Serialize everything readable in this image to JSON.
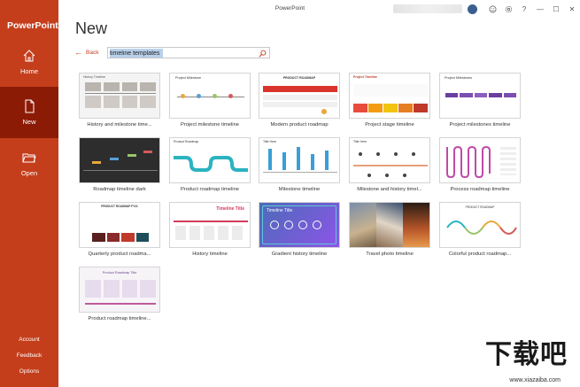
{
  "app": {
    "brand": "PowerPoint",
    "window_title": "PowerPoint"
  },
  "sidebar": {
    "items": [
      {
        "label": "Home",
        "icon": "home-icon"
      },
      {
        "label": "New",
        "icon": "new-file-icon"
      },
      {
        "label": "Open",
        "icon": "folder-open-icon"
      }
    ],
    "bottom": [
      "Account",
      "Feedback",
      "Options"
    ]
  },
  "titlebar": {
    "avatar_initials": "",
    "help": "?",
    "min": "—",
    "max": "☐",
    "close": "✕"
  },
  "main": {
    "heading": "New",
    "back_label": "Back",
    "search_value": "timeline templates"
  },
  "templates": [
    {
      "caption": "History and milestone time..."
    },
    {
      "caption": "Project milestone timeline"
    },
    {
      "caption": "Modern product roadmap"
    },
    {
      "caption": "Project stage timeline"
    },
    {
      "caption": "Project milestones timeline"
    },
    {
      "caption": "Roadmap timeline dark"
    },
    {
      "caption": "Product roadmap timeline"
    },
    {
      "caption": "Milestone timeline"
    },
    {
      "caption": "Milestone and history timel..."
    },
    {
      "caption": "Process roadmap timeline"
    },
    {
      "caption": "Quarterly product roadma..."
    },
    {
      "caption": "History timeline"
    },
    {
      "caption": "Gradient history timeline"
    },
    {
      "caption": "Travel photo timeline"
    },
    {
      "caption": "Colorful product roadmap..."
    },
    {
      "caption": "Product roadmap timeline..."
    }
  ],
  "thumb_text": {
    "t1": "History Timeline",
    "t2": "Project Milestone",
    "t3": "PRODUCT ROADMAP",
    "t4": "Project Timeline",
    "t5": "Project Milestones",
    "t7": "Product Roadmap",
    "t8": "Title Here",
    "t9": "Title Here",
    "t11": "PRODUCT ROADMAP FY21",
    "t12": "Timeline Title",
    "t13": "Timeline Title",
    "t15": "PRODUCT ROADMAP",
    "t16": "Product Roadmap Title"
  },
  "watermark": {
    "logo": "下载吧",
    "url": "www.xiazaiba.com"
  },
  "colors": {
    "accent": "#c43e1c",
    "accent_dark": "#8c1b06"
  }
}
